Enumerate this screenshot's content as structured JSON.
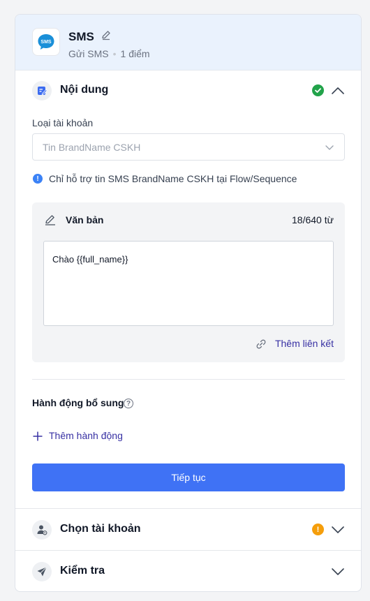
{
  "header": {
    "title": "SMS",
    "subtitle_type": "Gửi SMS",
    "subtitle_points": "1 điểm",
    "app_icon_text": "SMS",
    "app_icon_color": "#1a8fd8"
  },
  "content_section": {
    "label": "Nội dung",
    "status": "complete",
    "status_color": "#22a34a",
    "account_type": {
      "label": "Loại tài khoản",
      "value": "Tin BrandName CSKH"
    },
    "info_note": "Chỉ hỗ trợ tin SMS BrandName CSKH tại Flow/Sequence",
    "text_panel": {
      "title": "Văn bản",
      "count": "18/640 từ",
      "message": "Chào {{full_name}}",
      "add_link_label": "Thêm liên kết"
    },
    "extra_actions": {
      "label": "Hành động bổ sung",
      "add_label": "Thêm hành động"
    },
    "continue_label": "Tiếp tục",
    "accent_color": "#3f72f5"
  },
  "account_section": {
    "label": "Chọn tài khoản",
    "status": "warning",
    "status_color": "#f59e0b"
  },
  "check_section": {
    "label": "Kiểm tra"
  }
}
